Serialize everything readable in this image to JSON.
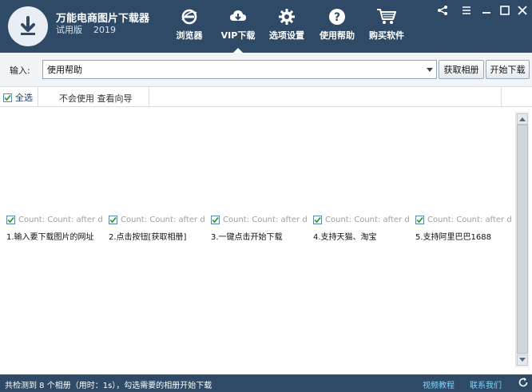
{
  "header": {
    "app_name": "万能电商图片下载器",
    "edition": "试用版",
    "year": "2019",
    "nav": [
      {
        "label": "浏览器",
        "icon": "browser-e-icon"
      },
      {
        "label": "VIP下载",
        "icon": "cloud-download-icon",
        "active": true
      },
      {
        "label": "选项设置",
        "icon": "gear-icon"
      },
      {
        "label": "使用帮助",
        "icon": "question-icon"
      },
      {
        "label": "购买软件",
        "icon": "cart-icon"
      }
    ],
    "window_controls": [
      "share-icon",
      "menu-icon",
      "minimize-icon",
      "maximize-icon",
      "close-icon"
    ]
  },
  "input_row": {
    "label": "输入:",
    "value": "使用帮助",
    "fetch_button": "获取相册",
    "start_button": "开始下载"
  },
  "toolbar": {
    "select_all": "全选",
    "help_link": "不会使用 查看向导"
  },
  "items": [
    {
      "count": "Count: Count: after do...",
      "caption": "1.输入要下载图片的网址"
    },
    {
      "count": "Count: Count: after do...",
      "caption": "2.点击按钮[获取相册]"
    },
    {
      "count": "Count: Count: after do...",
      "caption": "3.一键点击开始下载"
    },
    {
      "count": "Count: Count: after do...",
      "caption": "4.支持天猫、淘宝"
    },
    {
      "count": "Count: Count: after do...",
      "caption": "5.支持阿里巴巴1688"
    }
  ],
  "status": {
    "text": "共检测到 8 个相册（用时：1s），勾选需要的相册开始下载",
    "video_link": "视频教程",
    "contact_link": "联系我们"
  },
  "colors": {
    "header_bg": "#2f4a66",
    "status_bg": "#2f4a66",
    "link": "#7fd4ff",
    "checkbox": "#3a9a3a"
  }
}
